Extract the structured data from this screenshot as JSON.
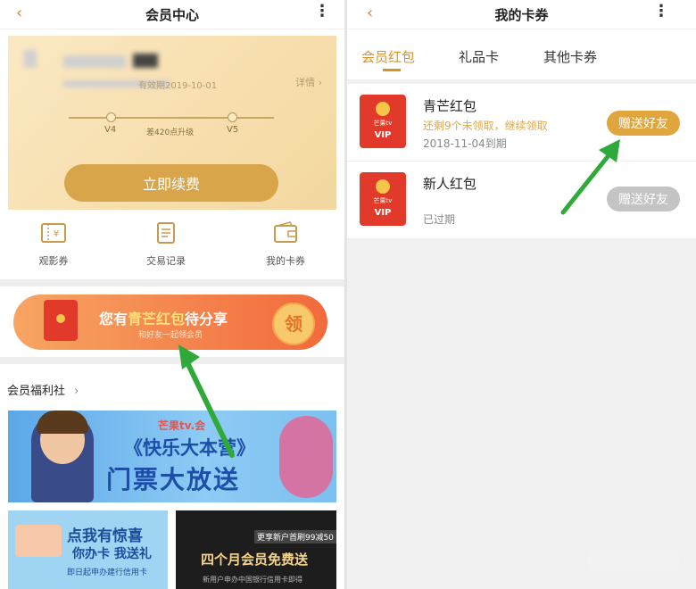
{
  "left": {
    "nav": {
      "title": "会员中心",
      "back": "‹",
      "more": "⋮"
    },
    "card": {
      "validity": "有效期2019-10-01",
      "details": "详情 ›",
      "levels": {
        "current": "V4",
        "gap": "差420点升级",
        "next": "V5"
      },
      "renew_button": "立即续费"
    },
    "quick_links": [
      {
        "label": "观影券"
      },
      {
        "label": "交易记录"
      },
      {
        "label": "我的卡券"
      }
    ],
    "banner": {
      "prefix": "您有",
      "highlight": "青芒红包",
      "suffix": "待分享",
      "subtitle": "和好友一起领会员",
      "claim": "领"
    },
    "welfare": {
      "title": "会员福利社",
      "chevron": "›"
    },
    "promos": {
      "p1": {
        "logo": "芒果tv.会",
        "line1": "《快乐大本营》",
        "line2": "门票大放送"
      },
      "p2": {
        "line1": "点我有惊喜",
        "line2": "你办卡 我送礼",
        "line3": "即日起申办建行信用卡"
      },
      "p3": {
        "tag": "更享新户首刷99减50",
        "line1": "四个月会员免费送",
        "line2": "新用户申办中国银行信用卡即得"
      }
    }
  },
  "right": {
    "nav": {
      "title": "我的卡券",
      "back": "‹",
      "more": "⋮"
    },
    "tabs": [
      {
        "label": "会员红包",
        "active": true
      },
      {
        "label": "礼品卡",
        "active": false
      },
      {
        "label": "其他卡券",
        "active": false
      }
    ],
    "items": [
      {
        "title": "青芒红包",
        "subtitle": "还剩9个未领取，继续领取",
        "date": "2018-11-04到期",
        "button": "赠送好友",
        "brand": "芒果tv",
        "badge": "VIP"
      },
      {
        "title": "新人红包",
        "status": "已过期",
        "button": "赠送好友",
        "brand": "芒果tv",
        "badge": "VIP"
      }
    ]
  },
  "colors": {
    "accent": "#d8912b",
    "gold_button": "#e0a63d",
    "disabled_button": "#c4c4c4",
    "banner_orange": "#f26a3c",
    "arrow_green": "#2faa3a"
  }
}
